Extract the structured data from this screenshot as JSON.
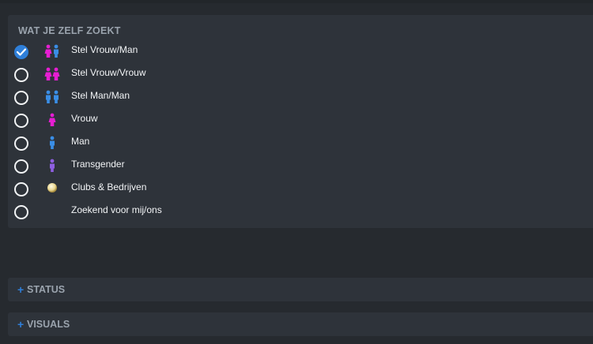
{
  "panel": {
    "title": "WAT JE ZELF ZOEKT",
    "options": [
      {
        "label": "Stel Vrouw/Man",
        "checked": true,
        "icon": "couple-woman-man-icon"
      },
      {
        "label": "Stel Vrouw/Vrouw",
        "checked": false,
        "icon": "couple-woman-woman-icon"
      },
      {
        "label": "Stel Man/Man",
        "checked": false,
        "icon": "couple-man-man-icon"
      },
      {
        "label": "Vrouw",
        "checked": false,
        "icon": "woman-icon"
      },
      {
        "label": "Man",
        "checked": false,
        "icon": "man-icon"
      },
      {
        "label": "Transgender",
        "checked": false,
        "icon": "transgender-icon"
      },
      {
        "label": "Clubs & Bedrijven",
        "checked": false,
        "icon": "club-icon"
      },
      {
        "label": "Zoekend voor mij/ons",
        "checked": false,
        "icon": ""
      }
    ]
  },
  "sections": {
    "status": {
      "plus": "+",
      "title": "STATUS"
    },
    "visuals": {
      "plus": "+",
      "title": "VISUALS"
    }
  },
  "colors": {
    "accent": "#2f7fd9",
    "female": "#e61ed2",
    "male": "#3a8ee6",
    "transgender": "#8e5fe0"
  }
}
